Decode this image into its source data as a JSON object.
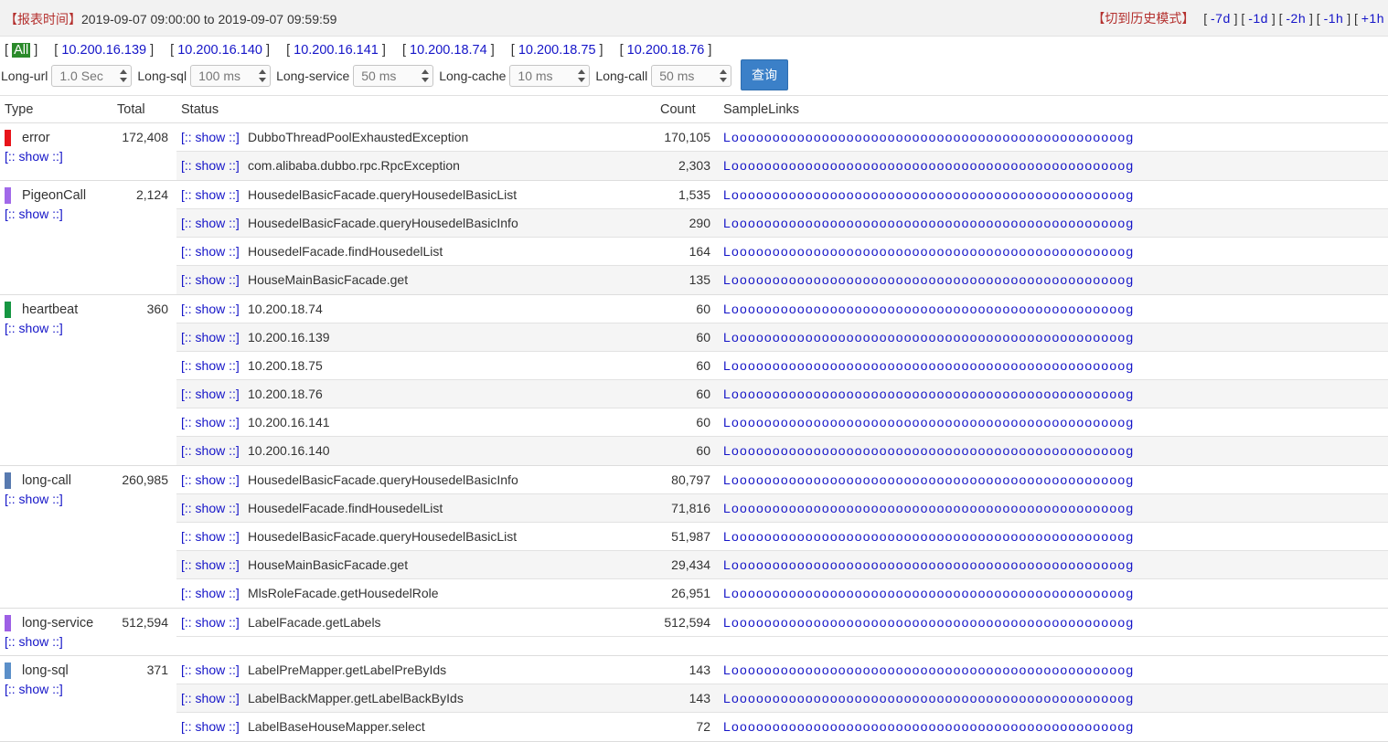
{
  "report": {
    "label": "【报表时间】",
    "range": "2019-09-07 09:00:00 to 2019-09-07 09:59:59"
  },
  "history": {
    "label": "【切到历史模式】",
    "links": [
      "-7d",
      "-1d",
      "-2h",
      "-1h",
      "+1h"
    ]
  },
  "ips": [
    "All",
    "10.200.16.139",
    "10.200.16.140",
    "10.200.16.141",
    "10.200.18.74",
    "10.200.18.75",
    "10.200.18.76"
  ],
  "filters": [
    {
      "label": "Long-url",
      "value": "1.0 Sec"
    },
    {
      "label": "Long-sql",
      "value": "100 ms"
    },
    {
      "label": "Long-service",
      "value": "50 ms"
    },
    {
      "label": "Long-cache",
      "value": "10 ms"
    },
    {
      "label": "Long-call",
      "value": "50 ms"
    }
  ],
  "query_label": "查询",
  "columns": {
    "type": "Type",
    "total": "Total",
    "status": "Status",
    "count": "Count",
    "samples": "SampleLinks"
  },
  "show_label": "[:: show ::]",
  "sample_text": "Loooooooooooooooooooooooooooooooooooooooooooooooog",
  "groups": [
    {
      "name": "error",
      "color": "#e8141a",
      "total": "172,408",
      "rows": [
        {
          "name": "DubboThreadPoolExhaustedException",
          "count": "170,105"
        },
        {
          "name": "com.alibaba.dubbo.rpc.RpcException",
          "count": "2,303"
        }
      ]
    },
    {
      "name": "PigeonCall",
      "color": "#a169e9",
      "total": "2,124",
      "rows": [
        {
          "name": "HousedelBasicFacade.queryHousedelBasicList",
          "count": "1,535"
        },
        {
          "name": "HousedelBasicFacade.queryHousedelBasicInfo",
          "count": "290"
        },
        {
          "name": "HousedelFacade.findHousedelList",
          "count": "164"
        },
        {
          "name": "HouseMainBasicFacade.get",
          "count": "135"
        }
      ]
    },
    {
      "name": "heartbeat",
      "color": "#169642",
      "total": "360",
      "rows": [
        {
          "name": "10.200.18.74",
          "count": "60"
        },
        {
          "name": "10.200.16.139",
          "count": "60"
        },
        {
          "name": "10.200.18.75",
          "count": "60"
        },
        {
          "name": "10.200.18.76",
          "count": "60"
        },
        {
          "name": "10.200.16.141",
          "count": "60"
        },
        {
          "name": "10.200.16.140",
          "count": "60"
        }
      ]
    },
    {
      "name": "long-call",
      "color": "#587ab0",
      "total": "260,985",
      "rows": [
        {
          "name": "HousedelBasicFacade.queryHousedelBasicInfo",
          "count": "80,797"
        },
        {
          "name": "HousedelFacade.findHousedelList",
          "count": "71,816"
        },
        {
          "name": "HousedelBasicFacade.queryHousedelBasicList",
          "count": "51,987"
        },
        {
          "name": "HouseMainBasicFacade.get",
          "count": "29,434"
        },
        {
          "name": "MlsRoleFacade.getHousedelRole",
          "count": "26,951"
        }
      ]
    },
    {
      "name": "long-service",
      "color": "#9d5fe5",
      "total": "512,594",
      "rows": [
        {
          "name": "LabelFacade.getLabels",
          "count": "512,594"
        }
      ]
    },
    {
      "name": "long-sql",
      "color": "#5b8fc9",
      "total": "371",
      "rows": [
        {
          "name": "LabelPreMapper.getLabelPreByIds",
          "count": "143"
        },
        {
          "name": "LabelBackMapper.getLabelBackByIds",
          "count": "143"
        },
        {
          "name": "LabelBaseHouseMapper.select",
          "count": "72"
        }
      ]
    }
  ]
}
